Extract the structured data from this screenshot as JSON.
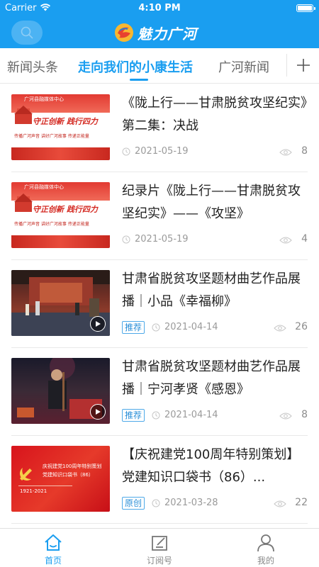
{
  "status_bar": {
    "carrier": "Carrier",
    "time": "4:10 PM"
  },
  "nav_bar": {
    "app_title": "魅力广河",
    "search_icon": "search-icon",
    "brand_color": "#1a9ef0"
  },
  "tabs": [
    {
      "label": "新闻头条",
      "active": false
    },
    {
      "label": "走向我们的小康生活",
      "active": true
    },
    {
      "label": "广河新闻",
      "active": false
    }
  ],
  "tab_add_icon": "plus-icon",
  "news": [
    {
      "title": "《陇上行——甘肃脱贫攻坚纪实》第二集：决战",
      "tag": "",
      "date": "2021-05-19",
      "views": "8",
      "thumb_text": [
        "广河县融媒体中心",
        "守正创新 践行四力",
        "传播广河声音 讲好广河故事 传递正能量"
      ],
      "has_video": false
    },
    {
      "title": "纪录片《陇上行——甘肃脱贫攻坚纪实》——《攻坚》",
      "tag": "",
      "date": "2021-05-19",
      "views": "4",
      "thumb_text": [
        "广河县融媒体中心",
        "守正创新 践行四力",
        "传播广河声音 讲好广河故事 传递正能量"
      ],
      "has_video": false
    },
    {
      "title": "甘肃省脱贫攻坚题材曲艺作品展播｜小品《幸福柳》",
      "tag": "推荐",
      "date": "2021-04-14",
      "views": "26",
      "has_video": true
    },
    {
      "title": "甘肃省脱贫攻坚题材曲艺作品展播｜宁河孝贤《感恩》",
      "tag": "推荐",
      "date": "2021-04-14",
      "views": "8",
      "has_video": true
    },
    {
      "title": "【庆祝建党100周年特别策划】党建知识口袋书（86）...",
      "tag": "原创",
      "date": "2021-03-28",
      "views": "22",
      "thumb_text": [
        "庆祝建党100周年特别策划",
        "党建知识口袋书（86）",
        "1921-2021"
      ],
      "has_video": false
    }
  ],
  "bottom_nav": [
    {
      "label": "首页",
      "icon": "home-icon",
      "active": true
    },
    {
      "label": "订阅号",
      "icon": "subscribe-icon",
      "active": false
    },
    {
      "label": "我的",
      "icon": "profile-icon",
      "active": false
    }
  ]
}
